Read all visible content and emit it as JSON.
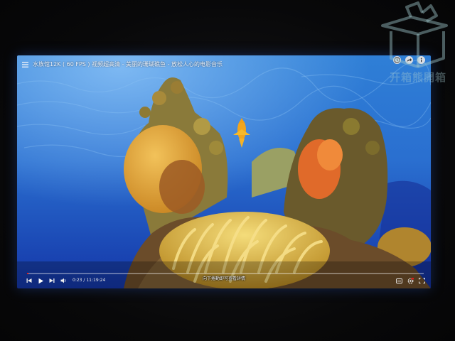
{
  "player": {
    "title": "水族馆12K ( 60 FPS ) 视频超高清 - 美丽的珊瑚礁鱼 - 放松人心的电影音乐",
    "subtitle": "向下捲動即可查看詳情",
    "time_current": "0:23",
    "time_total": "11:19:24",
    "progress": 0.0006,
    "accent_color": "#e11d1d"
  },
  "controls": {
    "left": [
      "previous-icon",
      "play-icon",
      "next-icon",
      "volume-icon"
    ],
    "right": [
      "subtitles-icon",
      "settings-icon",
      "fullscreen-icon"
    ]
  },
  "top_actions": [
    "clock-icon",
    "share-icon",
    "info-icon"
  ],
  "watermark": {
    "text": "开箱熊開箱",
    "icon": "open-box-icon"
  }
}
